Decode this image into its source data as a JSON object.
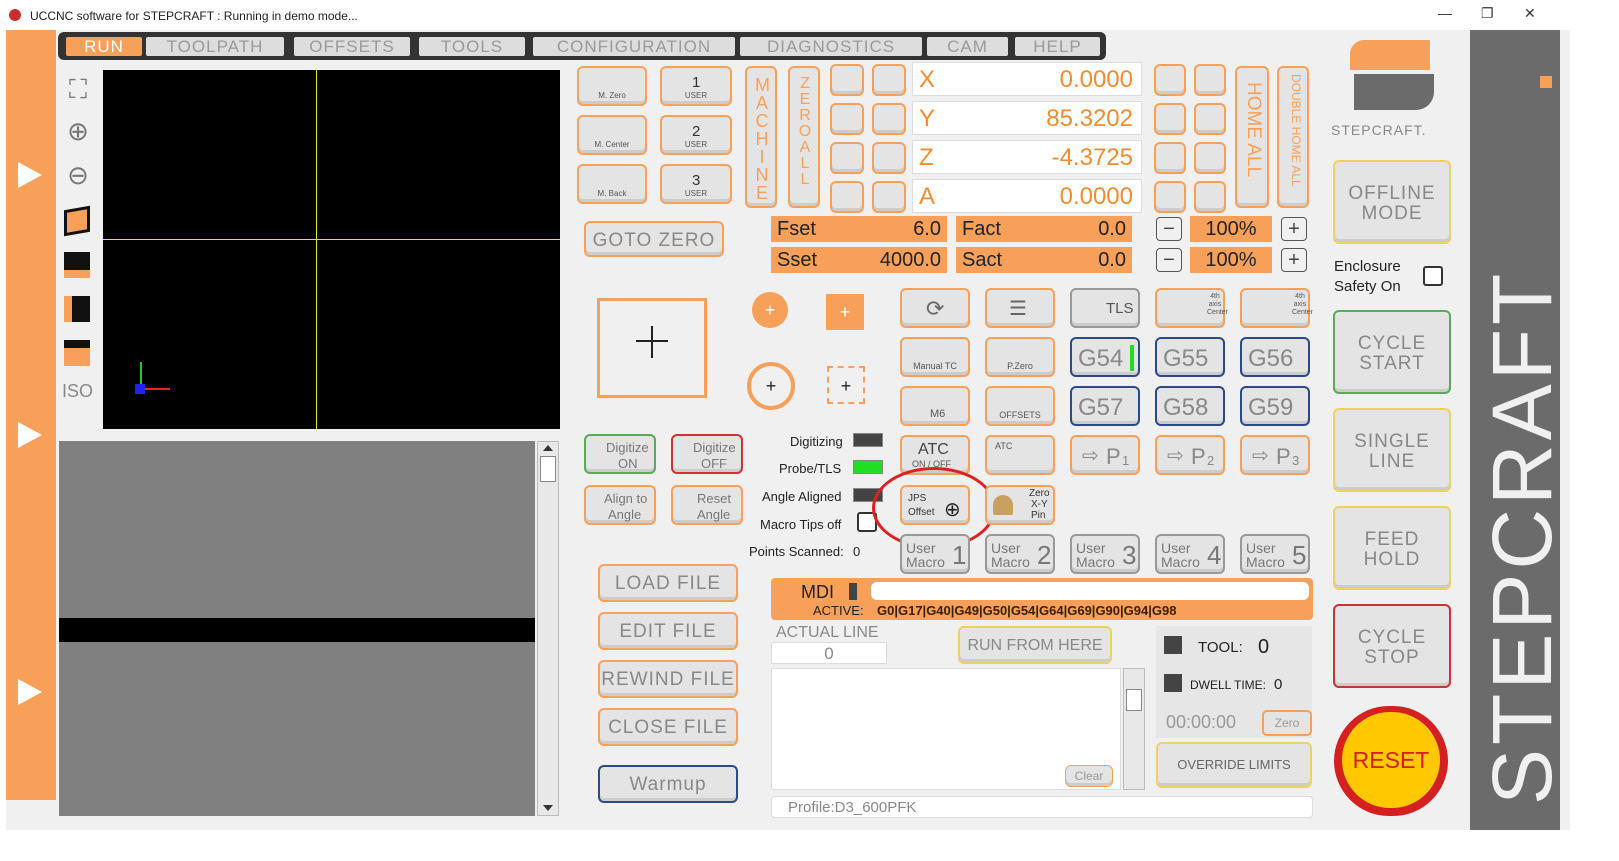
{
  "window": {
    "title": "UCCNC software for STEPCRAFT : Running in demo mode..."
  },
  "menu": {
    "tabs": [
      "RUN",
      "TOOLPATH",
      "OFFSETS",
      "TOOLS",
      "CONFIGURATION",
      "DIAGNOSTICS",
      "CAM",
      "HELP"
    ],
    "active": "RUN"
  },
  "side_tools": {
    "iso_label": "ISO"
  },
  "homing": {
    "m_zero": "M. Zero",
    "m_center": "M. Center",
    "m_back": "M. Back",
    "user_label": "USER",
    "user1": "1",
    "user2": "2",
    "user3": "3",
    "machine_letters": "MACHINE",
    "zero_all_letters": "ZERO ALL",
    "home_all": "HOME ALL",
    "double_home_all": "DOUBLE HOME ALL",
    "goto_zero": "GOTO ZERO"
  },
  "axes": [
    {
      "name": "X",
      "value": "0.0000"
    },
    {
      "name": "Y",
      "value": "85.3202"
    },
    {
      "name": "Z",
      "value": "-4.3725"
    },
    {
      "name": "A",
      "value": "0.0000"
    }
  ],
  "feed": {
    "fset_label": "Fset",
    "fset": "6.0",
    "fact_label": "Fact",
    "fact": "0.0",
    "f_override": "100%"
  },
  "spindle": {
    "sset_label": "Sset",
    "sset": "4000.0",
    "sact_label": "Sact",
    "sact": "0.0",
    "s_override": "100%"
  },
  "macros": {
    "tls": "TLS",
    "manual_tc": "Manual TC",
    "p_zero": "P.Zero",
    "m6": "M6",
    "offsets": "OFFSETS",
    "g54": "G54",
    "g55": "G55",
    "g56": "G56",
    "g57": "G57",
    "g58": "G58",
    "g59": "G59",
    "atc": "ATC",
    "atc_onoff": "ON / OFF",
    "atc_small": "ATC",
    "p1": "P",
    "p1n": "1",
    "p2": "P",
    "p2n": "2",
    "p3": "P",
    "p3n": "3",
    "jps_a": "JPS",
    "jps_b": "Offset",
    "zero_xy_pin_a": "Zero",
    "zero_xy_pin_b": "X-Y",
    "zero_xy_pin_c": "Pin",
    "user_macro_a": "User",
    "user_macro_b": "Macro",
    "um1": "1",
    "um2": "2",
    "um3": "3",
    "um4": "4",
    "um5": "5",
    "center4a": "4th axis Center",
    "center4b": "4th axis Center"
  },
  "probing": {
    "digitize_on_a": "Digitize",
    "digitize_on_b": "ON",
    "digitize_off_a": "Digitize",
    "digitize_off_b": "OFF",
    "align_a": "Align to",
    "align_b": "Angle",
    "reset_a": "Reset",
    "reset_b": "Angle",
    "digitizing": "Digitizing",
    "probe_tls": "Probe/TLS",
    "angle_aligned": "Angle Aligned",
    "macro_tips_off": "Macro Tips off",
    "points_scanned": "Points Scanned:",
    "points_value": "0"
  },
  "file": {
    "load": "LOAD FILE",
    "edit": "EDIT FILE",
    "rewind": "REWIND FILE",
    "close": "CLOSE FILE",
    "warmup": "Warmup"
  },
  "mdi": {
    "label": "MDI",
    "active_label": "ACTIVE:",
    "active_codes": "G0|G17|G40|G49|G50|G54|G64|G69|G90|G94|G98"
  },
  "status": {
    "actual_line_label": "ACTUAL LINE",
    "actual_line": "0",
    "run_from_here": "RUN FROM HERE",
    "tool_label": "TOOL:",
    "tool": "0",
    "dwell_label": "DWELL TIME:",
    "dwell": "0",
    "timer": "00:00:00",
    "zero": "Zero",
    "override_limits": "OVERRIDE LIMITS",
    "clear": "Clear",
    "profile": "Profile:D3_600PFK"
  },
  "right_panel": {
    "logo_text": "STEPCRAFT.",
    "offline_a": "OFFLINE",
    "offline_b": "MODE",
    "enclosure_a": "Enclosure",
    "enclosure_b": "Safety On",
    "cycle_start_a": "CYCLE",
    "cycle_start_b": "START",
    "single_line_a": "SINGLE",
    "single_line_b": "LINE",
    "feed_hold_a": "FEED",
    "feed_hold_b": "HOLD",
    "cycle_stop_a": "CYCLE",
    "cycle_stop_b": "STOP",
    "reset": "RESET",
    "brand_vertical": "STEPCRAFT"
  },
  "colors": {
    "accent": "#f7a05a",
    "led_green": "#22dd22",
    "reset_yellow": "#ffc800",
    "reset_red": "#d42020"
  }
}
